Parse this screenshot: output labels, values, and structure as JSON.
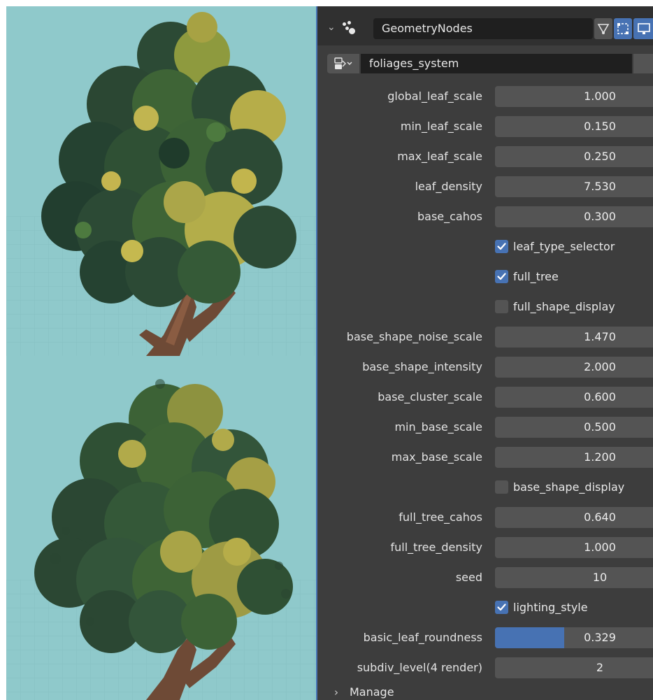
{
  "modifier": {
    "name": "GeometryNodes",
    "node_group": "foliages_system",
    "header_icons": [
      "node-tree-icon",
      "edit-mode-icon",
      "realtime-display-icon"
    ]
  },
  "properties": [
    {
      "type": "value",
      "label": "global_leaf_scale",
      "value": "1.000"
    },
    {
      "type": "value",
      "label": "min_leaf_scale",
      "value": "0.150"
    },
    {
      "type": "value",
      "label": "max_leaf_scale",
      "value": "0.250"
    },
    {
      "type": "value",
      "label": "leaf_density",
      "value": "7.530"
    },
    {
      "type": "value",
      "label": "base_cahos",
      "value": "0.300"
    },
    {
      "type": "checkbox",
      "label": "leaf_type_selector",
      "checked": true
    },
    {
      "type": "checkbox",
      "label": "full_tree",
      "checked": true
    },
    {
      "type": "checkbox",
      "label": "full_shape_display",
      "checked": false
    },
    {
      "type": "value",
      "label": "base_shape_noise_scale",
      "value": "1.470"
    },
    {
      "type": "value",
      "label": "base_shape_intensity",
      "value": "2.000"
    },
    {
      "type": "value",
      "label": "base_cluster_scale",
      "value": "0.600"
    },
    {
      "type": "value",
      "label": "min_base_scale",
      "value": "0.500"
    },
    {
      "type": "value",
      "label": "max_base_scale",
      "value": "1.200"
    },
    {
      "type": "checkbox",
      "label": "base_shape_display",
      "checked": false
    },
    {
      "type": "value",
      "label": "full_tree_cahos",
      "value": "0.640"
    },
    {
      "type": "value",
      "label": "full_tree_density",
      "value": "1.000"
    },
    {
      "type": "value",
      "label": "seed",
      "value": "10"
    },
    {
      "type": "checkbox",
      "label": "lighting_style",
      "checked": true
    },
    {
      "type": "slider",
      "label": "basic_leaf_roundness",
      "value": "0.329",
      "fraction": 0.329
    },
    {
      "type": "value",
      "label": "subdiv_level(4 render)",
      "value": "2"
    }
  ],
  "manage_label": "Manage",
  "colors": {
    "sky": "#8fc9cb",
    "panel_bg": "#3d3d3d",
    "field_bg": "#545454",
    "accent": "#4772b3"
  }
}
